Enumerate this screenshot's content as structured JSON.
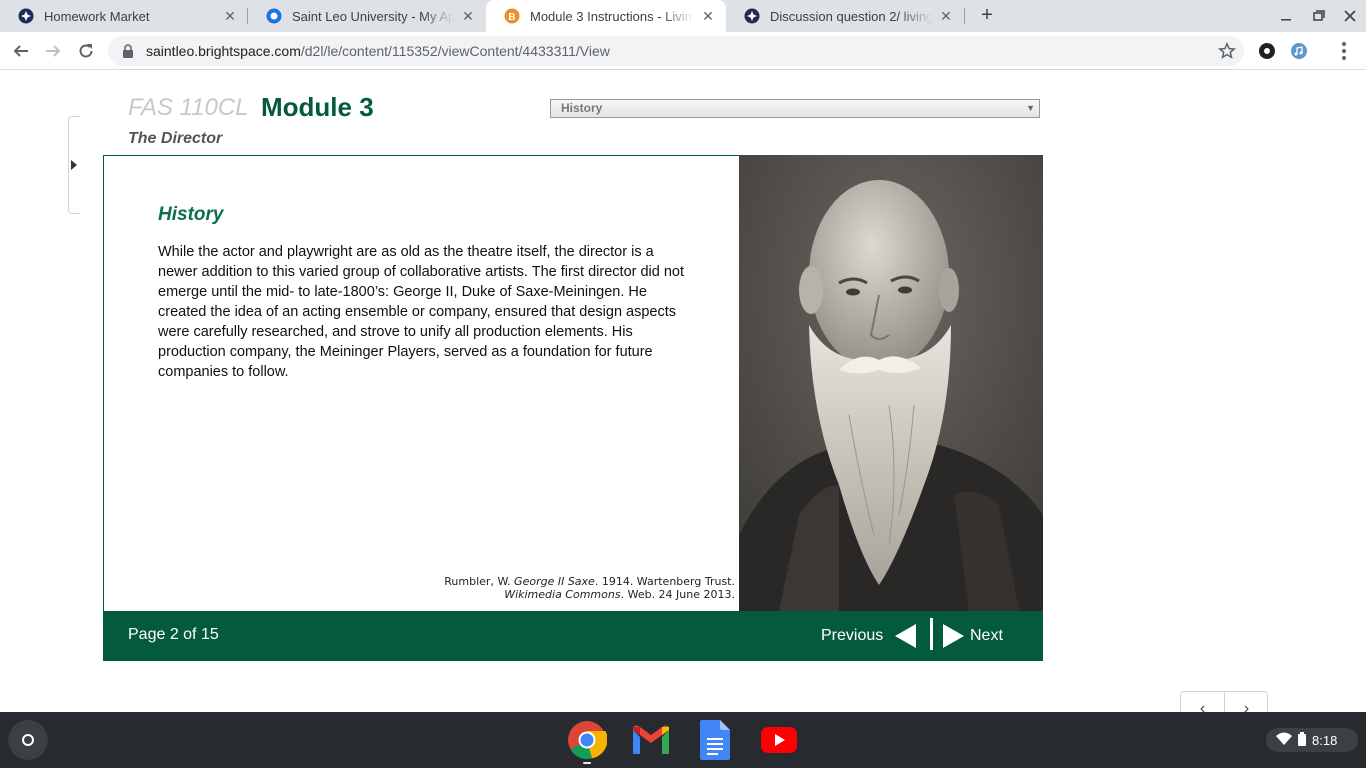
{
  "browser": {
    "tabs": [
      {
        "title": "Homework Market",
        "icon": "homework-market-favicon"
      },
      {
        "title": "Saint Leo University - My Applica",
        "icon": "saint-leo-favicon"
      },
      {
        "title": "Module 3 Instructions - Living th",
        "icon": "brightspace-favicon"
      },
      {
        "title": "Discussion question 2/ living the",
        "icon": "homework-market-favicon"
      }
    ],
    "active_tab": 2,
    "url_host": "saintleo.brightspace.com",
    "url_path": "/d2l/le/content/115352/viewContent/4433311/View"
  },
  "page": {
    "course": "FAS 110CL",
    "module": "Module 3",
    "subtitle": "The Director",
    "page_select": "History",
    "section_title": "History",
    "body": "While the actor and playwright are as old as the theatre itself, the director is a newer addition to this varied group of collaborative artists. The first director did not emerge until the mid- to late-1800’s: George II, Duke of Saxe-Meiningen. He created the idea of an acting ensemble or company, ensured that design aspects were carefully researched, and strove to unify all production elements. His production company, the Meininger Players, served as a foundation for future companies to follow.",
    "caption": {
      "author": "Rumbler, W. ",
      "work": "George II Saxe",
      "rest1": ". 1914. Wartenberg Trust.",
      "source": "Wikimedia Commons",
      "rest2": ". Web. 24 June 2013."
    },
    "footer": {
      "page_count": "Page 2 of 15",
      "previous": "Previous",
      "next": "Next"
    }
  },
  "pager": {
    "prev": "‹",
    "next": "›"
  },
  "shelf": {
    "apps": [
      "chrome-icon",
      "gmail-icon",
      "docs-icon",
      "youtube-icon"
    ],
    "time": "8:18"
  },
  "colors": {
    "brand_green": "#045a3f",
    "title_green": "#0b7047"
  }
}
